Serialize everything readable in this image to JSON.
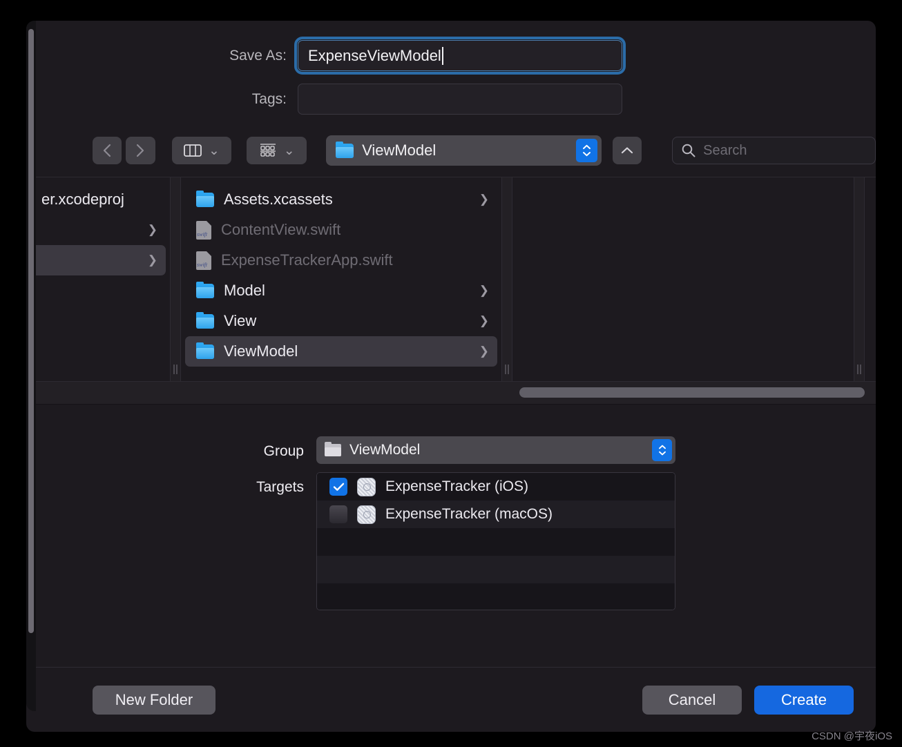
{
  "save_as": {
    "label": "Save As:",
    "value": "ExpenseViewModel"
  },
  "tags": {
    "label": "Tags:",
    "value": "",
    "placeholder": ""
  },
  "toolbar": {
    "back_icon": "chevron-left-icon",
    "forward_icon": "chevron-right-icon",
    "view_mode_icon": "column-view-icon",
    "group_by_icon": "group-grid-icon",
    "dropdown_icon": "chevron-down-icon",
    "path_value": "ViewModel",
    "path_folder_icon": "folder-icon",
    "stepper_up": "▲",
    "stepper_down": "▼",
    "up_button_icon": "chevron-up-icon",
    "search_icon": "search-icon",
    "search_placeholder": "Search",
    "search_value": ""
  },
  "browser": {
    "column1": {
      "items": [
        {
          "label": "er.xcodeproj",
          "icon": "none",
          "has_arrow": false,
          "selected": false,
          "dim": false
        },
        {
          "label": "",
          "icon": "none",
          "has_arrow": true,
          "selected": false,
          "dim": false
        },
        {
          "label": "",
          "icon": "none",
          "has_arrow": true,
          "selected": true,
          "dim": false
        }
      ]
    },
    "column2": {
      "items": [
        {
          "label": "Assets.xcassets",
          "icon": "folder-icon",
          "has_arrow": true,
          "selected": false,
          "dim": false
        },
        {
          "label": "ContentView.swift",
          "icon": "swift-file-icon",
          "has_arrow": false,
          "selected": false,
          "dim": true
        },
        {
          "label": "ExpenseTrackerApp.swift",
          "icon": "swift-file-icon",
          "has_arrow": false,
          "selected": false,
          "dim": true
        },
        {
          "label": "Model",
          "icon": "folder-icon",
          "has_arrow": true,
          "selected": false,
          "dim": false
        },
        {
          "label": "View",
          "icon": "folder-icon",
          "has_arrow": true,
          "selected": false,
          "dim": false
        },
        {
          "label": "ViewModel",
          "icon": "folder-icon",
          "has_arrow": true,
          "selected": true,
          "dim": false
        }
      ]
    },
    "column3": {
      "items": []
    }
  },
  "accessory": {
    "group": {
      "label": "Group",
      "value": "ViewModel",
      "folder_icon": "folder-icon",
      "stepper_up": "▲",
      "stepper_down": "▼"
    },
    "targets": {
      "label": "Targets",
      "rows": [
        {
          "label": "ExpenseTracker (iOS)",
          "checked": true,
          "icon": "app-target-icon",
          "check_glyph": "✓"
        },
        {
          "label": "ExpenseTracker (macOS)",
          "checked": false,
          "icon": "app-target-icon",
          "check_glyph": ""
        },
        {
          "label": "",
          "checked": false,
          "icon": "",
          "check_glyph": ""
        },
        {
          "label": "",
          "checked": false,
          "icon": "",
          "check_glyph": ""
        },
        {
          "label": "",
          "checked": false,
          "icon": "",
          "check_glyph": ""
        }
      ]
    }
  },
  "footer": {
    "new_folder_label": "New Folder",
    "cancel_label": "Cancel",
    "create_label": "Create"
  },
  "watermark": "CSDN @宇夜iOS",
  "colors": {
    "accent_blue": "#1173e6",
    "create_blue": "#1568e0",
    "focus_ring": "#2b6ca8",
    "dialog_bg": "#1d1a1f",
    "control_gray": "#4a484e"
  }
}
